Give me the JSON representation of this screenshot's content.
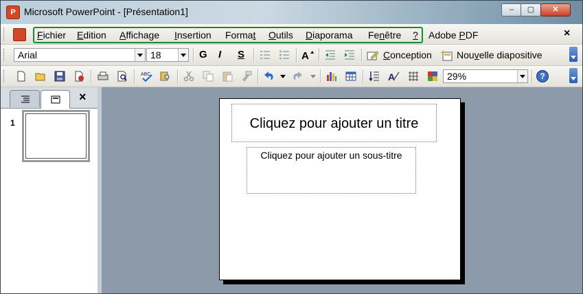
{
  "window": {
    "title": "Microsoft PowerPoint - [Présentation1]",
    "app_icon_glyph": "P",
    "controls": {
      "minimize": "–",
      "maximize": "▢",
      "close": "✕"
    }
  },
  "menubar": {
    "items": [
      {
        "mnemonic": "F",
        "rest": "ichier"
      },
      {
        "mnemonic": "E",
        "rest": "dition"
      },
      {
        "mnemonic": "A",
        "rest": "ffichage"
      },
      {
        "mnemonic": "I",
        "rest": "nsertion"
      },
      {
        "pre": "Forma",
        "mnemonic": "t",
        "rest": ""
      },
      {
        "mnemonic": "O",
        "rest": "utils"
      },
      {
        "mnemonic": "D",
        "rest": "iaporama"
      },
      {
        "pre": "Fe",
        "mnemonic": "n",
        "rest": "être"
      },
      {
        "mnemonic": "?",
        "rest": ""
      }
    ],
    "adobe_pre": "Adobe ",
    "adobe_mnemonic": "P",
    "adobe_rest": "DF",
    "close_glyph": "×"
  },
  "formatting": {
    "font_name": "Arial",
    "font_size": "18",
    "bold": "G",
    "italic": "I",
    "shadow": "S",
    "conception_pre": "",
    "conception_mnemonic": "C",
    "conception_rest": "onception",
    "new_slide_pre": "Nou",
    "new_slide_mnemonic": "v",
    "new_slide_rest": "elle diapositive"
  },
  "standard": {
    "zoom": "29%",
    "help_glyph": "?"
  },
  "panes": {
    "close_glyph": "×",
    "slide_number": "1"
  },
  "slide": {
    "title_placeholder": "Cliquez pour ajouter un titre",
    "subtitle_placeholder": "Cliquez pour ajouter un sous-titre"
  },
  "colors": {
    "accent_green": "#178a35",
    "workspace": "#8d9aaa",
    "title_bar": "#bdcfdc"
  }
}
